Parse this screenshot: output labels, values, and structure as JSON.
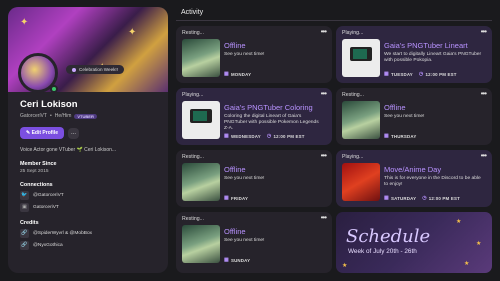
{
  "profile": {
    "tooltip": "Celebration Week!!",
    "name": "Ceri Lokison",
    "handle": "GatorceriVT",
    "pronouns": "He/Him",
    "badge": "VTUBER",
    "edit_label": "Edit Profile",
    "more_label": "...",
    "bio": "Voice Actor gone VTuber 🌱 Ceri Lokison...",
    "member_since_label": "Member Since",
    "member_since": "25 Sept 2015",
    "connections_label": "Connections",
    "connections": [
      "@GatorceriVT",
      "GatorceriVT"
    ],
    "credits_label": "Credits",
    "credits": [
      "@SpiderWyvrl & @MobBox",
      "@NyxGothica"
    ]
  },
  "activity": {
    "heading": "Activity",
    "cards": [
      {
        "state": "Resting...",
        "title": "Offline",
        "desc": "See you next time!",
        "day": "MONDAY",
        "time": ""
      },
      {
        "state": "Playing...",
        "title": "Gaia's PNGTuber Lineart",
        "desc": "We start to digitally Lineart Gaia's PNGTuber with possible Pokopia.",
        "day": "TUESDAY",
        "time": "12:00 PM EST"
      },
      {
        "state": "Playing...",
        "title": "Gaia's PNGTuber Coloring",
        "desc": "Coloring the digital Lineart of Gaia's PNGTuber with possible Pokemon Legends Z-A.",
        "day": "WEDNESDAY",
        "time": "12:00 PM EST"
      },
      {
        "state": "Resting...",
        "title": "Offline",
        "desc": "See you next time!",
        "day": "THURSDAY",
        "time": ""
      },
      {
        "state": "Resting...",
        "title": "Offline",
        "desc": "See you next time!",
        "day": "FRIDAY",
        "time": ""
      },
      {
        "state": "Playing...",
        "title": "Move/Anime Day",
        "desc": "This is for everyone in the Discord to be able to enjoy!",
        "day": "SATURDAY",
        "time": "12:00 PM EST"
      },
      {
        "state": "Resting...",
        "title": "Offline",
        "desc": "See you next time!",
        "day": "SUNDAY",
        "time": ""
      }
    ],
    "more_label": "•••"
  },
  "schedule": {
    "title": "Schedule",
    "week": "Week of July 20th - 26th"
  },
  "colors": {
    "accent": "#7b4fe0",
    "title_purple": "#b892ff",
    "online": "#3bc46a"
  }
}
